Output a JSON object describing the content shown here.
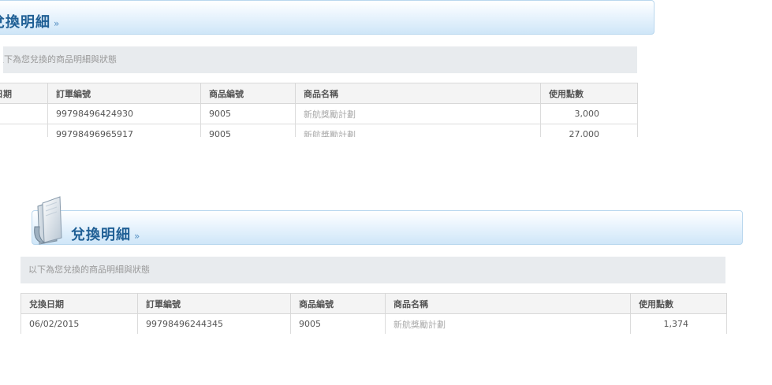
{
  "sections": [
    {
      "title": "兌換明細",
      "subtitle": "以下為您兌換的商品明細與狀態",
      "columns": [
        "兌換日期",
        "訂單編號",
        "商品編號",
        "商品名稱",
        "使用點數"
      ],
      "rows": [
        {
          "date": "",
          "order": "99798496424930",
          "product_id": "9005",
          "product_name": "新航獎勵計劃",
          "points": "3,000"
        },
        {
          "date": "",
          "order": "99798496965917",
          "product_id": "9005",
          "product_name": "新航獎勵計劃",
          "points": "27,000"
        }
      ]
    },
    {
      "title": "兌換明細",
      "subtitle": "以下為您兌換的商品明細與狀態",
      "columns": [
        "兌換日期",
        "訂單編號",
        "商品編號",
        "商品名稱",
        "使用點數"
      ],
      "rows": [
        {
          "date": "06/02/2015",
          "order": "99798496244345",
          "product_id": "9005",
          "product_name": "新航獎勵計劃",
          "points": "1,374"
        }
      ]
    }
  ],
  "colors": {
    "title": "#1f5f95",
    "header_gradient_bottom": "#cfe6f8",
    "subbar": "#e8ebee"
  },
  "icons": [
    "raquo-icon",
    "folder-icon"
  ]
}
